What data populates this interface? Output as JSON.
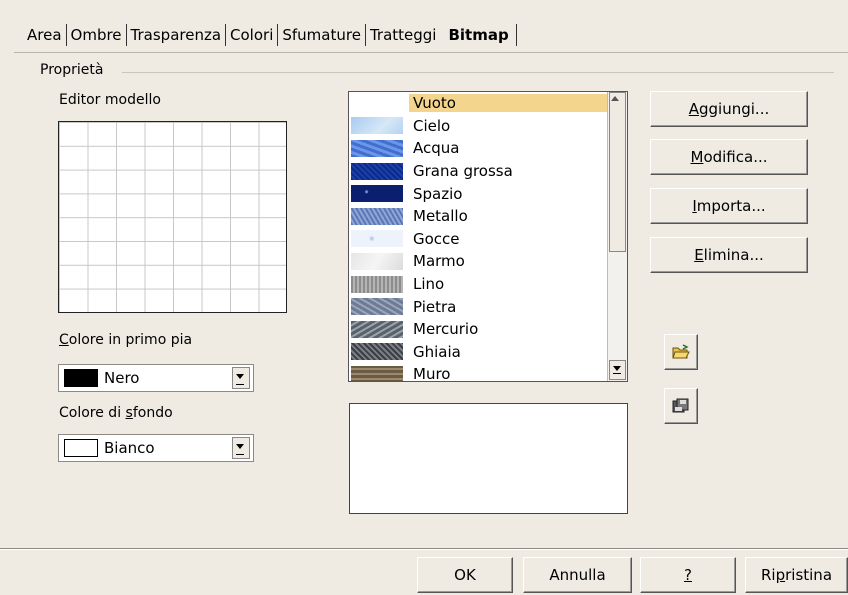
{
  "tabs": [
    "Area",
    "Ombre",
    "Trasparenza",
    "Colori",
    "Sfumature",
    "Tratteggi",
    "Bitmap"
  ],
  "active_tab": "Bitmap",
  "group": {
    "label": "Proprietà"
  },
  "editor": {
    "label": "Editor modello"
  },
  "foreground": {
    "label_u": "C",
    "label_rest": "olore in primo pia",
    "value": "Nero",
    "color": "#000000"
  },
  "background": {
    "label_pre": "Colore di ",
    "label_u": "s",
    "label_rest": "fondo",
    "value": "Bianco",
    "color": "#ffffff"
  },
  "bitmap_list": {
    "selected": "Vuoto",
    "items": [
      {
        "name": "Vuoto",
        "swatch": "vuoto"
      },
      {
        "name": "Cielo",
        "swatch": "cielo"
      },
      {
        "name": "Acqua",
        "swatch": "acqua"
      },
      {
        "name": "Grana grossa",
        "swatch": "grana"
      },
      {
        "name": "Spazio",
        "swatch": "spazio"
      },
      {
        "name": "Metallo",
        "swatch": "metallo"
      },
      {
        "name": "Gocce",
        "swatch": "gocce"
      },
      {
        "name": "Marmo",
        "swatch": "marmo"
      },
      {
        "name": "Lino",
        "swatch": "lino"
      },
      {
        "name": "Pietra",
        "swatch": "pietra"
      },
      {
        "name": "Mercurio",
        "swatch": "mercurio"
      },
      {
        "name": "Ghiaia",
        "swatch": "ghiaia"
      },
      {
        "name": "Muro",
        "swatch": "muro"
      }
    ]
  },
  "side_buttons": {
    "add": {
      "u": "A",
      "rest": "ggiungi..."
    },
    "modify": {
      "u": "M",
      "rest": "odifica..."
    },
    "import": {
      "u": "I",
      "rest": "mporta..."
    },
    "delete": {
      "u": "E",
      "rest": "limina..."
    }
  },
  "icons": {
    "open": "open-folder-icon",
    "save": "save-icon"
  },
  "footer": {
    "ok": "OK",
    "cancel": "Annulla",
    "help": "?",
    "reset_pre": "Ri",
    "reset_u": "p",
    "reset_rest": "ristina"
  }
}
